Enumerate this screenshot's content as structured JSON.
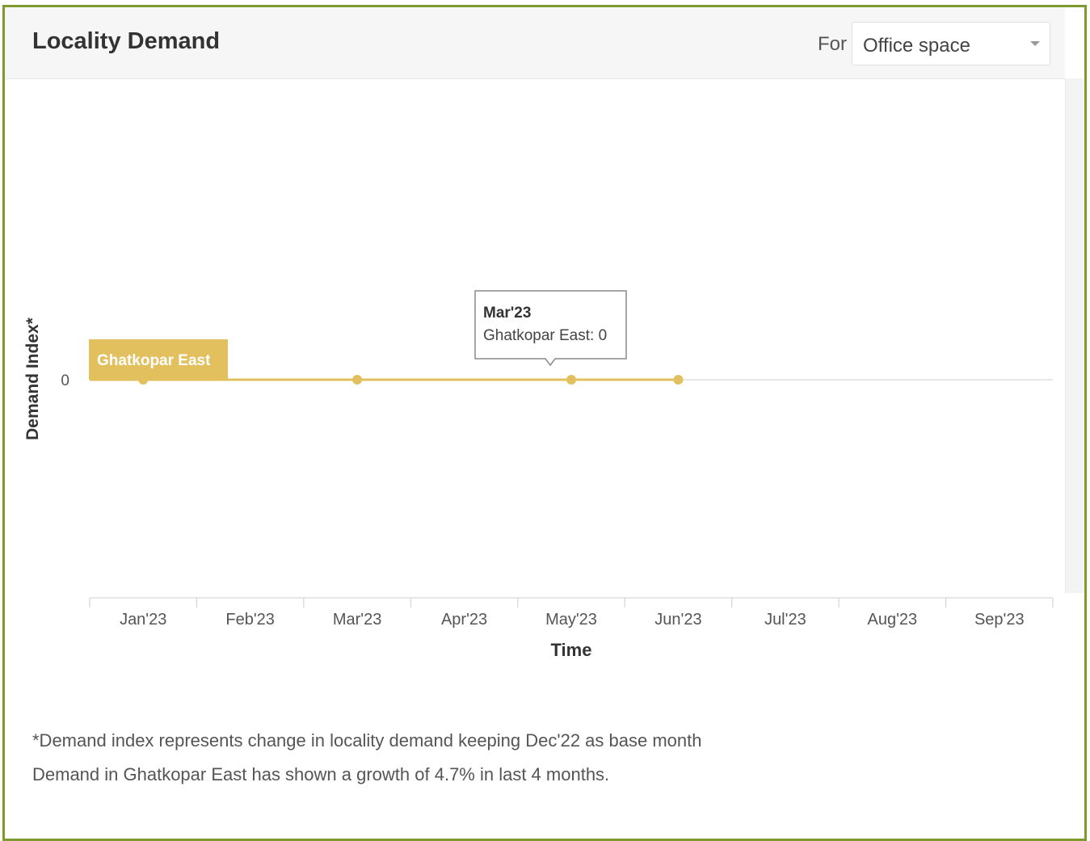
{
  "widget": {
    "title": "Locality Demand",
    "for_label": "For",
    "selected_option": "Office space"
  },
  "chart_data": {
    "type": "line",
    "ylabel": "Demand Index*",
    "xlabel": "Time",
    "y_ticks": [
      0
    ],
    "categories": [
      "Jan'23",
      "Feb'23",
      "Mar'23",
      "Apr'23",
      "May'23",
      "Jun'23",
      "Jul'23",
      "Aug'23",
      "Sep'23"
    ],
    "series": [
      {
        "name": "Ghatkopar East",
        "color": "#e2c05e",
        "points": [
          {
            "x": "Jan'23",
            "y": 0
          },
          {
            "x": "Mar'23",
            "y": 0
          },
          {
            "x": "May'23",
            "y": 0
          },
          {
            "x": "Jun'23",
            "y": 0
          }
        ]
      }
    ],
    "tooltip": {
      "title": "Mar'23",
      "text": "Ghatkopar East: 0"
    },
    "grid": false
  },
  "footnotes": {
    "note": "*Demand index represents change in locality demand keeping Dec'22 as base month",
    "growth": "Demand in Ghatkopar East has shown a growth of 4.7% in last 4 months."
  }
}
